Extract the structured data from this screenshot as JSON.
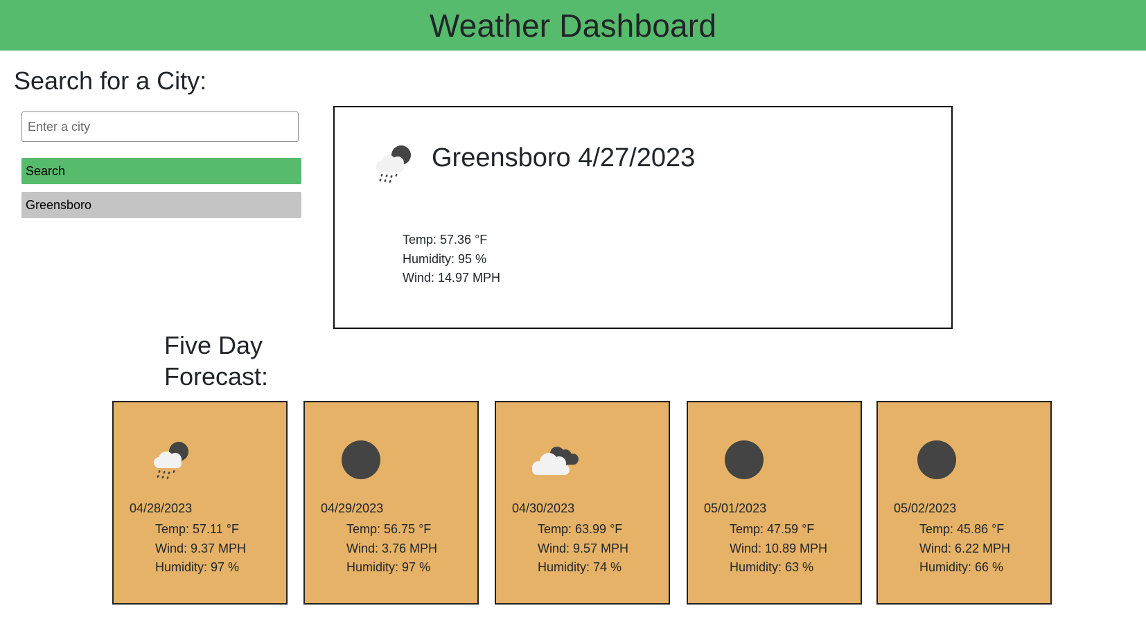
{
  "header": {
    "title": "Weather Dashboard"
  },
  "search": {
    "title": "Search for a City:",
    "placeholder": "Enter a city",
    "value": "",
    "search_label": "Search",
    "history": [
      "Greensboro"
    ]
  },
  "current": {
    "title": "Greensboro 4/27/2023",
    "icon": "rain-cloud-night-icon",
    "temp": "Temp: 57.36 °F",
    "humidity": "Humidity: 95 %",
    "wind": "Wind: 14.97 MPH"
  },
  "forecast": {
    "title": "Five Day Forecast:",
    "days": [
      {
        "date": "04/28/2023",
        "icon": "rain-cloud-night-icon",
        "temp": "Temp: 57.11 °F",
        "wind": "Wind: 9.37 MPH",
        "humidity": "Humidity: 97 %"
      },
      {
        "date": "04/29/2023",
        "icon": "clear-night-icon",
        "temp": "Temp: 56.75 °F",
        "wind": "Wind: 3.76 MPH",
        "humidity": "Humidity: 97 %"
      },
      {
        "date": "04/30/2023",
        "icon": "broken-clouds-icon",
        "temp": "Temp: 63.99 °F",
        "wind": "Wind: 9.57 MPH",
        "humidity": "Humidity: 74 %"
      },
      {
        "date": "05/01/2023",
        "icon": "clear-night-icon",
        "temp": "Temp: 47.59 °F",
        "wind": "Wind: 10.89 MPH",
        "humidity": "Humidity: 63 %"
      },
      {
        "date": "05/02/2023",
        "icon": "clear-night-icon",
        "temp": "Temp: 45.86 °F",
        "wind": "Wind: 6.22 MPH",
        "humidity": "Humidity: 66 %"
      }
    ]
  },
  "colors": {
    "header_bg": "#56bb6c",
    "search_button": "#56bb6c",
    "history_button": "#c4c4c4",
    "forecast_card": "#e5b267",
    "icon_dark": "#444444",
    "cloud_light": "#f2f2f2"
  }
}
